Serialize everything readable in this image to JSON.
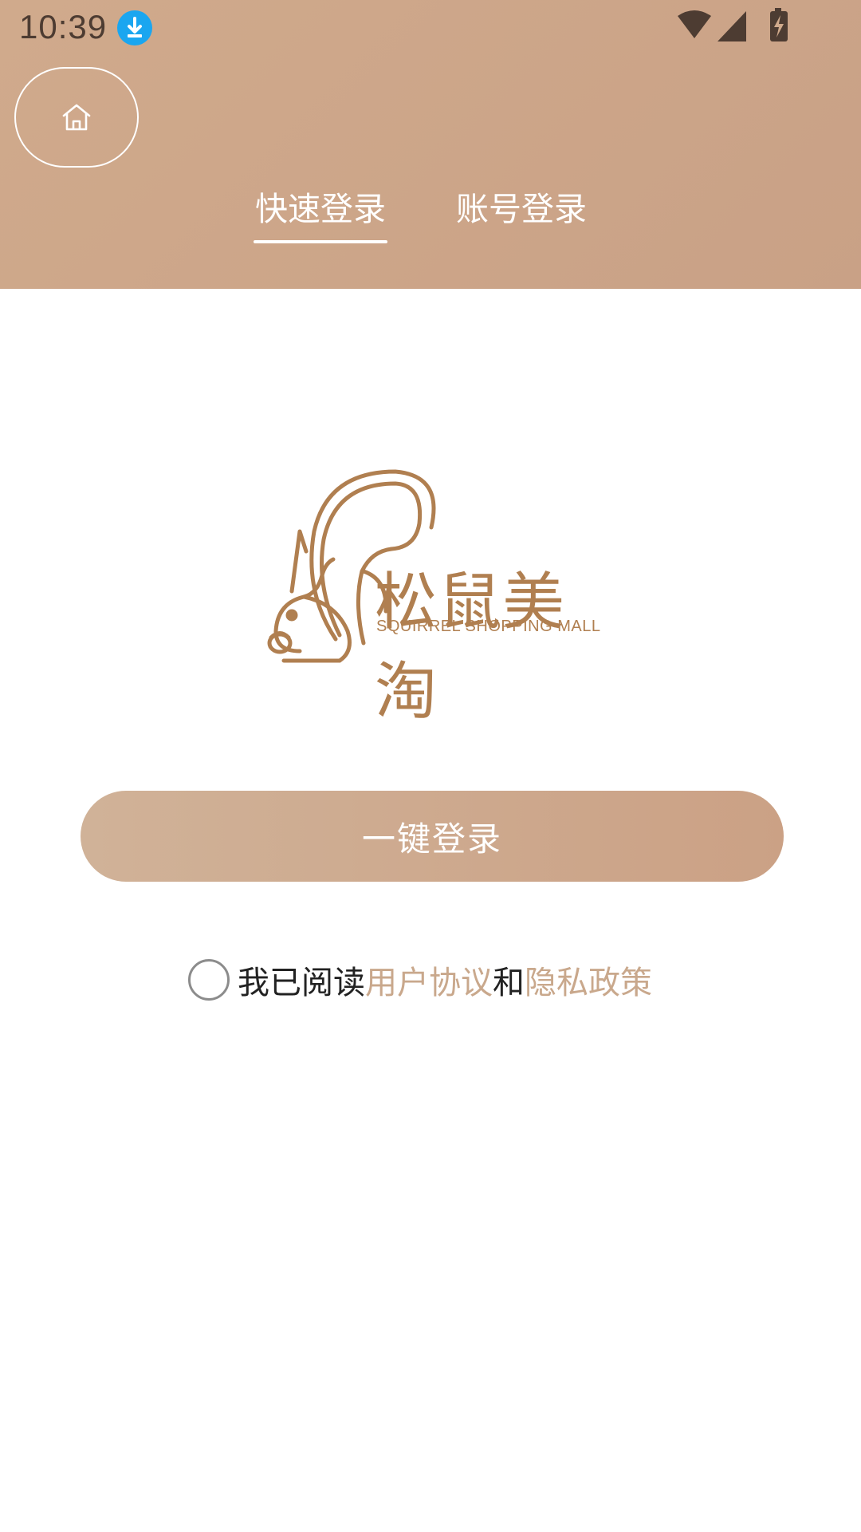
{
  "status_bar": {
    "time": "10:39",
    "icons": [
      "download-icon",
      "wifi-icon",
      "signal-icon",
      "battery-charging-icon"
    ]
  },
  "colors": {
    "header_gradient": [
      "#d0aa8c",
      "#c9a186"
    ],
    "brand": "#b07f50",
    "link": "#c9a88c",
    "button_gradient": [
      "#d0b298",
      "#cba185"
    ]
  },
  "tabs": [
    {
      "label": "快速登录",
      "active": true
    },
    {
      "label": "账号登录",
      "active": false
    }
  ],
  "logo": {
    "name_cn": "松鼠美淘",
    "name_en": "SQUIRREL SHOPPING MALL"
  },
  "login_button": {
    "label": "一键登录"
  },
  "agreement": {
    "prefix": "我已阅读",
    "user_agreement": "用户协议",
    "and": "和",
    "privacy_policy": "隐私政策",
    "checked": false
  }
}
